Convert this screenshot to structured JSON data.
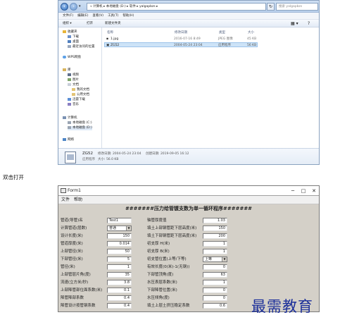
{
  "explorer": {
    "address": "«  计算机 ▸ 本地磁盘 (D:) ▸ 软件 ▸ yalgapbzs ▸",
    "search_placeholder": "搜索 yalgapbzs",
    "menu": [
      "文件(F)",
      "编辑(E)",
      "查看(V)",
      "工具(T)",
      "帮助(H)"
    ],
    "toolbar": {
      "organize": "组织 ▾",
      "open": "打开",
      "new_folder": "新建文件夹"
    },
    "nav": {
      "favorites": "收藏夹",
      "fav_items": [
        "下载",
        "桌面",
        "最近访问的位置"
      ],
      "wps": "WPS网盘",
      "libraries": "库",
      "lib_items": [
        "视频",
        "图片",
        "文档",
        "迅雷下载",
        "音乐"
      ],
      "lib_sub": [
        "我的文档",
        "公用文档"
      ],
      "computer": "计算机",
      "comp_items": [
        "本地磁盘 (C:)",
        "本地磁盘 (D:)"
      ],
      "network": "网络"
    },
    "columns": {
      "name": "名称",
      "date": "修改日期",
      "type": "类型",
      "size": "大小"
    },
    "files": [
      {
        "name": "1.jpg",
        "date": "2016-07-16 8:49",
        "type": "JPEG 图像",
        "size": "45 KB"
      },
      {
        "name": "ZG52",
        "date": "2004-05-24 23:04",
        "type": "应用程序",
        "size": "56 KB"
      }
    ],
    "details": {
      "name": "ZG52",
      "type": "应用程序",
      "modified": "修改日期: 2004-05-24 23:04",
      "size": "大小: 56.0 KB",
      "created": "创建日期: 2019-09-05 16:12"
    }
  },
  "caption": "双击打开",
  "form": {
    "title": "Form1",
    "menu": {
      "file": "文件",
      "help": "帮助"
    },
    "heading": "#######压力给管镀支数为单一循环程序#######",
    "left_fields": [
      {
        "label": "管道(导管)名",
        "value": "Test1"
      },
      {
        "label": "计算管道(层数)",
        "value": "普通"
      },
      {
        "label": "设计长度(米)",
        "value": "150"
      },
      {
        "label": "管道厚度(米)",
        "value": "0.014"
      },
      {
        "label": "上部管径(米)",
        "value": "50"
      },
      {
        "label": "下部管径(米)",
        "value": "5"
      },
      {
        "label": "管径(米)",
        "value": "1"
      },
      {
        "label": "上部管层片角(度)",
        "value": "35"
      },
      {
        "label": "流速(立方米/秒)",
        "value": "3.8"
      },
      {
        "label": "上部降管部位面系数(米)",
        "value": "0.1"
      },
      {
        "label": "降管降部系数",
        "value": "0.4"
      },
      {
        "label": "降管设计按管钢系数",
        "value": "0.4"
      }
    ],
    "right_fields": [
      {
        "label": "轴管厚度值",
        "value": "1.03"
      },
      {
        "label": "填土上部钢管距下层高度(米)",
        "value": "150"
      },
      {
        "label": "填土下部钢管距下层高度(米)",
        "value": "200"
      },
      {
        "label": "初支厚 H(米)",
        "value": "1"
      },
      {
        "label": "初支厚 B(米)",
        "value": "1"
      },
      {
        "label": "初支管位置(上等/下等)",
        "value": "上等"
      },
      {
        "label": "有效长度(0(米)-1(无钢))",
        "value": "0"
      },
      {
        "label": "下部管顶角(度)",
        "value": "63"
      },
      {
        "label": "水压表层系数(米)",
        "value": "1"
      },
      {
        "label": "下部降管位置(米)",
        "value": "0"
      },
      {
        "label": "水压倾角(度)",
        "value": "0"
      },
      {
        "label": "填土上层土挤压稳定系数",
        "value": "0.6"
      }
    ]
  },
  "watermark": "最需教育"
}
